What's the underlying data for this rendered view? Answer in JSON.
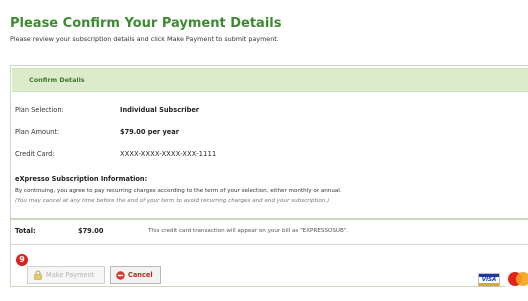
{
  "header": {
    "title": "Please Confirm Your Payment Details",
    "subtitle": "Please review your subscription details and click Make Payment to submit payment."
  },
  "section": {
    "title": "Confirm Details"
  },
  "details": [
    {
      "label": "Plan Selection:",
      "value": "Individual Subscriber"
    },
    {
      "label": "Plan Amount:",
      "value": "$79.00 per year"
    },
    {
      "label": "Credit Card:",
      "value": "XXXX-XXXX-XXXX-XXX-1111"
    }
  ],
  "info": {
    "heading": "eXpresso Subscription Information:",
    "text": "By continuing, you agree to pay recurring charges according to the term of your selection, either monthly or annual.",
    "note": "(You may cancel at any time before the end of your term to avoid recurring charges and end your subscription.)"
  },
  "total": {
    "label": "Total:",
    "amount": "$79.00",
    "note": "This credit card transaction will appear on your bill as \"EXPRESSOSUB\"."
  },
  "step_badge": "9",
  "buttons": {
    "make_payment": "Make Payment",
    "make_payment_state": "disabled",
    "cancel": "Cancel"
  },
  "card_logos": {
    "visa": "VISA",
    "mastercard_icon": "mastercard-logo"
  },
  "colors": {
    "title_green": "#3d8a32",
    "section_bar": "#dcebc9",
    "badge_red": "#d8241c",
    "cancel_red": "#c0281d"
  }
}
